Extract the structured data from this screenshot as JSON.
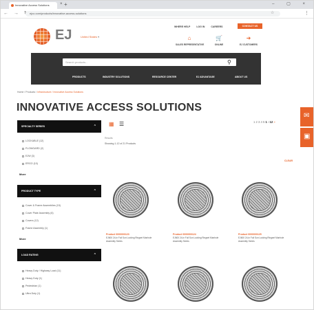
{
  "browser": {
    "tab_title": "Innovative Access Solutions",
    "url": "ejco.com/products/innovative-access-solutions",
    "close_glyph": "×",
    "newtab_glyph": "+",
    "window_controls": "– ▢ ×",
    "nav_glyphs": "← → ↻",
    "star_glyph": "☆",
    "menu_glyph": "⋮"
  },
  "header": {
    "logo_text": "EJ",
    "location_prefix": "",
    "location_value": "United States",
    "top_links": [
      "WHERE HELP",
      "LOG IN",
      "CAREERS"
    ],
    "contact_label": "CONTACT US",
    "icons": [
      {
        "name": "pin-icon",
        "glyph": "⌂",
        "label": "SALES REPRESENTATIVE"
      },
      {
        "name": "cart-icon",
        "glyph": "🛒",
        "label": "ONLINE"
      },
      {
        "name": "login-icon",
        "glyph": "➜",
        "label": "EJ CUSTOMERS"
      }
    ]
  },
  "search": {
    "placeholder": "Search products..."
  },
  "nav": {
    "items": [
      "PRODUCTS",
      "INDUSTRY SOLUTIONS",
      "RESOURCE CENTER",
      "EJ ADVANTAGE",
      "ABOUT US"
    ]
  },
  "breadcrumb": {
    "home": "Home / Products /",
    "trail": " Infrastructure / Innovative Access Solutions"
  },
  "page": {
    "title": "INNOVATIVE ACCESS SOLUTIONS"
  },
  "sidebar": {
    "panels": [
      {
        "title": "SPECIALTY SERIES",
        "caret": "⌃",
        "items": [
          "LOCKABLE (12)",
          "FLOWGARD (2)",
          "EJW (3)",
          "ERGO (10)"
        ],
        "more": "More"
      },
      {
        "title": "PRODUCT TYPE",
        "caret": "⌃",
        "items": [
          "Cover & Frame Assemblies (15)",
          "Cover Plate Assembly (6)",
          "Covers (12)",
          "Frame Assembly (1)"
        ],
        "more": "More"
      },
      {
        "title": "LOAD RATING",
        "caret": "⌃",
        "items": [
          "Heavy Duty / Highway Load (11)",
          "Heavy Duty (1)",
          "Pedestrian (1)",
          "Ultra Duty (1)"
        ]
      }
    ]
  },
  "results": {
    "grid_glyph": "▦",
    "list_glyph": "☰",
    "label": "Results",
    "showing": "Showing 1-12 of 21 Products",
    "pager": {
      "pages": "1 2 3 4 5",
      "range": "1 - 12",
      "next": "»"
    },
    "clear_all": "CLEAR",
    "products": [
      {
        "number": "Product 0000000123",
        "desc": "EJ600 24-in Full Sun Locking Ringset Manhole Assembly Series"
      },
      {
        "number": "Product 0000000124",
        "desc": "EJ600 24-in Full Sun Locking Ringset Manhole Assembly Series"
      },
      {
        "number": "Product 0000000125",
        "desc": "EJ600 24-in Full Sun Locking Ringset Manhole Assembly Series"
      }
    ]
  },
  "sidetabs": {
    "email_glyph": "✉",
    "chat_glyph": "▣"
  },
  "colors": {
    "accent": "#e8632a",
    "band": "#333333",
    "panel": "#111111"
  }
}
